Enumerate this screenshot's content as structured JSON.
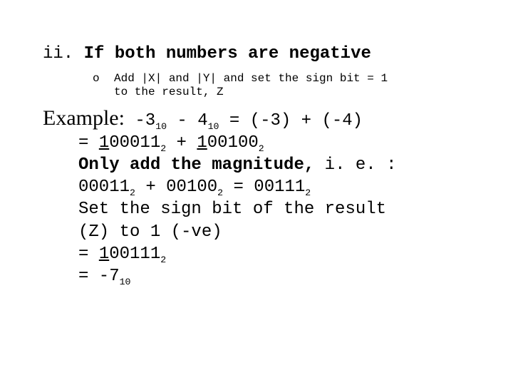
{
  "heading": {
    "marker": "ii.",
    "text": "If both numbers are negative"
  },
  "bullet": {
    "marker": "o",
    "line1": "Add |X| and |Y| and set the sign bit = 1",
    "line2": "to the result, Z"
  },
  "example": {
    "label": "Example:",
    "expr_pre": " -3",
    "sub10a": "10",
    "expr_mid1": " - 4",
    "sub10b": "10",
    "expr_post": " = (-3) + (-4)"
  },
  "l2": {
    "pre": "= ",
    "u1": "1",
    "mid1": "00011",
    "sub2a": "2",
    "plus": " + ",
    "u2": "1",
    "mid2": "00100",
    "sub2b": "2"
  },
  "l3": {
    "bold": "Only add the magnitude,",
    "rest": " i. e. :"
  },
  "l4": {
    "a": "00011",
    "sub2a": "2",
    "plus": " + 00100",
    "sub2b": "2",
    "eq": " = 00111",
    "sub2c": "2"
  },
  "l5": {
    "text": "Set the sign bit of the result"
  },
  "l6": {
    "text": "(Z) to 1 (-ve)"
  },
  "l7": {
    "pre": "= ",
    "u": "1",
    "rest": "00111",
    "sub2": "2"
  },
  "l8": {
    "pre": "= -7",
    "sub10": "10"
  }
}
